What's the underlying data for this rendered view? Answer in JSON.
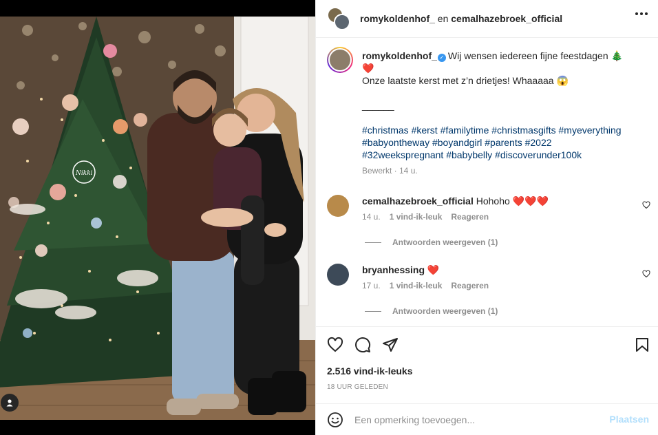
{
  "header": {
    "user1": "romykoldenhof_",
    "joiner": "en",
    "user2": "cemalhazebroek_official",
    "more_icon": "more-horizontal-icon"
  },
  "caption": {
    "username": "romykoldenhof_",
    "line1": "Wij wensen iedereen fijne feestdagen 🎄",
    "line1b": "❤️",
    "line2": "Onze laatste kerst met z’n drietjes! Whaaaaa 😱",
    "separator": "______",
    "hashtags_line1": "#christmas #kerst #familytime #christmasgifts #myeverything",
    "hashtags_line2": "#babyontheway #boyandgirl #parents #2022",
    "hashtags_line3": "#32weekspregnant #babybelly #discoverunder100k",
    "meta": "Bewerkt · 14 u."
  },
  "comments": [
    {
      "username": "cemalhazebroek_official",
      "text": "Hohoho ❤️❤️❤️",
      "time": "14 u.",
      "likes": "1 vind-ik-leuk",
      "reply": "Reageren",
      "view_replies": "Antwoorden weergeven (1)"
    },
    {
      "username": "bryanhessing",
      "text": "❤️",
      "time": "17 u.",
      "likes": "1 vind-ik-leuk",
      "reply": "Reageren",
      "view_replies": "Antwoorden weergeven (1)"
    }
  ],
  "actions": {
    "likes": "2.516 vind-ik-leuks",
    "time": "18 UUR GELEDEN"
  },
  "add_comment": {
    "placeholder": "Een opmerking toevoegen...",
    "post": "Plaatsen"
  },
  "photo": {
    "overlay_tag": "Nikki"
  },
  "colors": {
    "link": "#00376b",
    "muted": "#8e8e8e",
    "post_disabled": "#b2dffc",
    "verified": "#3897f0"
  }
}
